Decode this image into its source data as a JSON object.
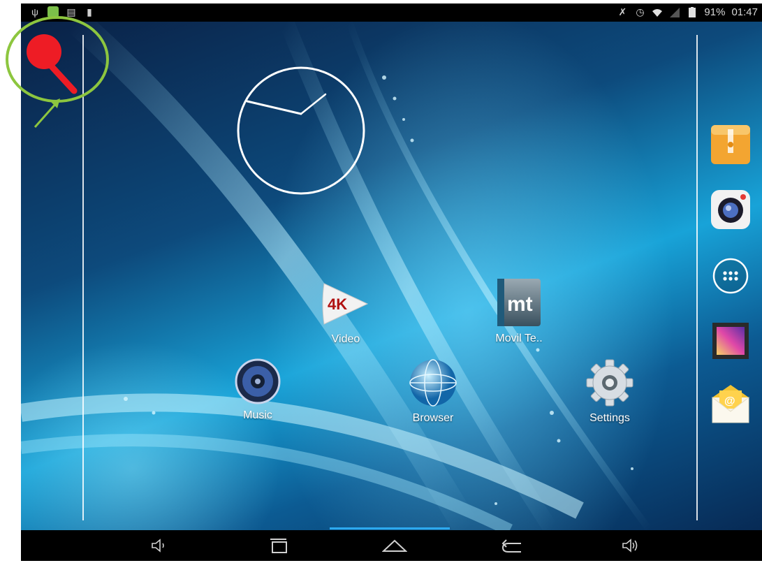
{
  "status_bar": {
    "battery": "91%",
    "time": "01:47"
  },
  "apps": [
    {
      "label": "Video",
      "icon": "4k-video-icon",
      "badge": "4K"
    },
    {
      "label": "Movil Te..",
      "icon": "mt-app-icon",
      "badge": "mt"
    },
    {
      "label": "Music",
      "icon": "speaker-icon"
    },
    {
      "label": "Browser",
      "icon": "globe-icon"
    },
    {
      "label": "Settings",
      "icon": "gear-icon"
    }
  ],
  "dock": [
    {
      "name": "file-manager-icon"
    },
    {
      "name": "camera-icon"
    },
    {
      "name": "app-drawer-icon"
    },
    {
      "name": "gallery-icon"
    },
    {
      "name": "email-icon",
      "badge": "@"
    }
  ],
  "nav": [
    "volume-down-icon",
    "recent-apps-icon",
    "home-icon",
    "back-icon",
    "volume-up-icon"
  ],
  "colors": {
    "nav_indicator": "#2ca9ef",
    "annotation_green": "#8dc63f",
    "magnifier_red": "#ee1c25"
  }
}
